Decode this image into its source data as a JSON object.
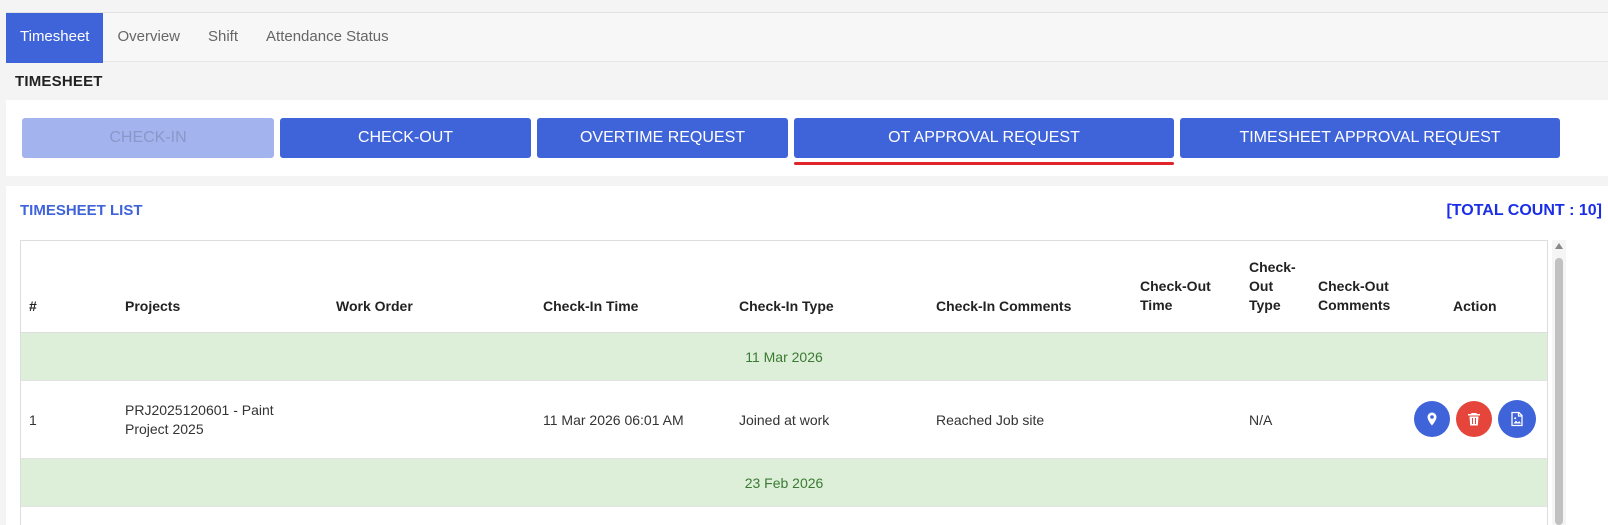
{
  "tabs": [
    {
      "label": "Timesheet",
      "active": true
    },
    {
      "label": "Overview",
      "active": false
    },
    {
      "label": "Shift",
      "active": false
    },
    {
      "label": "Attendance Status",
      "active": false
    }
  ],
  "section_title": "TIMESHEET",
  "actions": {
    "check_in": "CHECK-IN",
    "check_out": "CHECK-OUT",
    "overtime_request": "OVERTIME REQUEST",
    "ot_approval_request": "OT APPROVAL REQUEST",
    "timesheet_approval_request": "TIMESHEET APPROVAL REQUEST"
  },
  "list": {
    "title": "TIMESHEET LIST",
    "total_count": "[TOTAL COUNT : 10]",
    "columns": {
      "num": "#",
      "projects": "Projects",
      "work_order": "Work Order",
      "check_in_time": "Check-In Time",
      "check_in_type": "Check-In Type",
      "check_in_comments": "Check-In Comments",
      "check_out_time": "Check-Out Time",
      "check_out_type": "Check-Out Type",
      "check_out_comments": "Check-Out Comments",
      "action": "Action"
    },
    "groups": [
      {
        "date": "11 Mar 2026",
        "rows": [
          {
            "num": "1",
            "project": "PRJ2025120601 - Paint Project 2025",
            "work_order": "",
            "check_in_time": "11 Mar 2026 06:01 AM",
            "check_in_type": "Joined at work",
            "check_in_comments": "Reached Job site",
            "check_out_time": "",
            "check_out_type": "N/A",
            "check_out_comments": ""
          }
        ]
      },
      {
        "date": "23 Feb 2026",
        "rows": []
      }
    ]
  },
  "colors": {
    "primary": "#3f63d8",
    "danger": "#e5453a",
    "date_row_bg": "#ddefd8",
    "date_row_text": "#3b7a33",
    "total_count": "#1a2ee8"
  }
}
